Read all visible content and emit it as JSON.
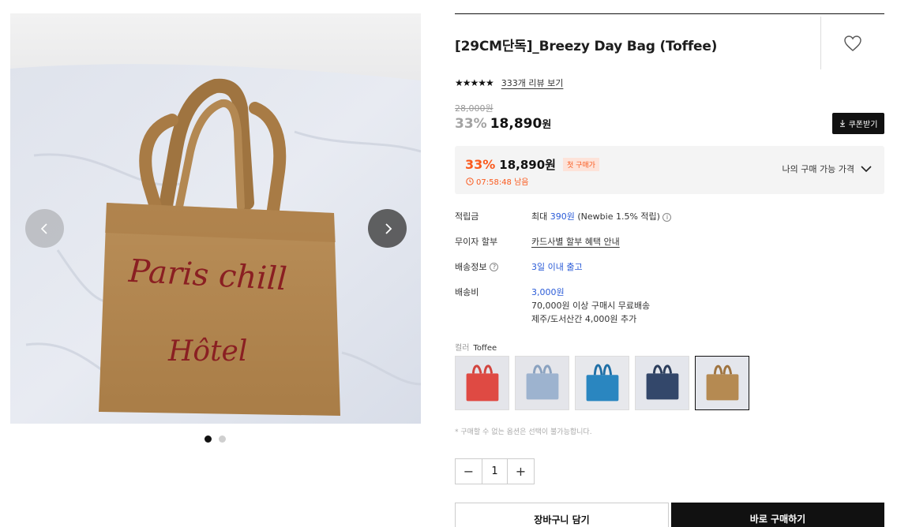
{
  "product": {
    "title": "[29CM단독]_Breezy Day Bag (Toffee)",
    "stars": "★★★★★",
    "review_link": "333개 리뷰 보기",
    "original_price": "28,000원",
    "discount": "33%",
    "price": "18,890",
    "won": "원",
    "coupon_button": "쿠폰받기"
  },
  "gallery": {
    "image_text_line1": "Paris chill",
    "image_text_line2": "Hôtel",
    "prev_icon": "chevron-left-icon",
    "next_icon": "chevron-right-icon",
    "slide_count": 2,
    "active_slide": 1
  },
  "first_purchase": {
    "discount": "33%",
    "price": "18,890원",
    "tag": "첫 구매가",
    "timer": "07:58:48 남음",
    "my_price_label": "나의 구매 가능 가격"
  },
  "details": {
    "points_label": "적립금",
    "points_prefix": "최대 ",
    "points_value": "390원",
    "points_suffix": " (Newbie 1.5% 적립)",
    "installment_label": "무이자 할부",
    "installment_value": "카드사별 할부 혜택 안내",
    "shipping_info_label": "배송정보",
    "shipping_info_value": "3일 이내 출고",
    "shipping_fee_label": "배송비",
    "shipping_fee_value": "3,000원",
    "shipping_fee_line2": "70,000원 이상 구매시 무료배송",
    "shipping_fee_line3": "제주/도서산간 4,000원 추가"
  },
  "color": {
    "label": "컬러",
    "selected": "Toffee",
    "options": [
      "Red",
      "Light Blue",
      "Blue",
      "Navy",
      "Toffee"
    ]
  },
  "notice": "* 구매할 수 없는 옵션은 선택이 불가능합니다.",
  "quantity": {
    "minus": "−",
    "value": "1",
    "plus": "+"
  },
  "actions": {
    "cart": "장바구니 담기",
    "buy": "바로 구매하기"
  },
  "colors": {
    "accent_orange": "#fa5a1e",
    "link_blue": "#2a5bd7",
    "black": "#111111",
    "bag_toffee": "#b58a52"
  }
}
